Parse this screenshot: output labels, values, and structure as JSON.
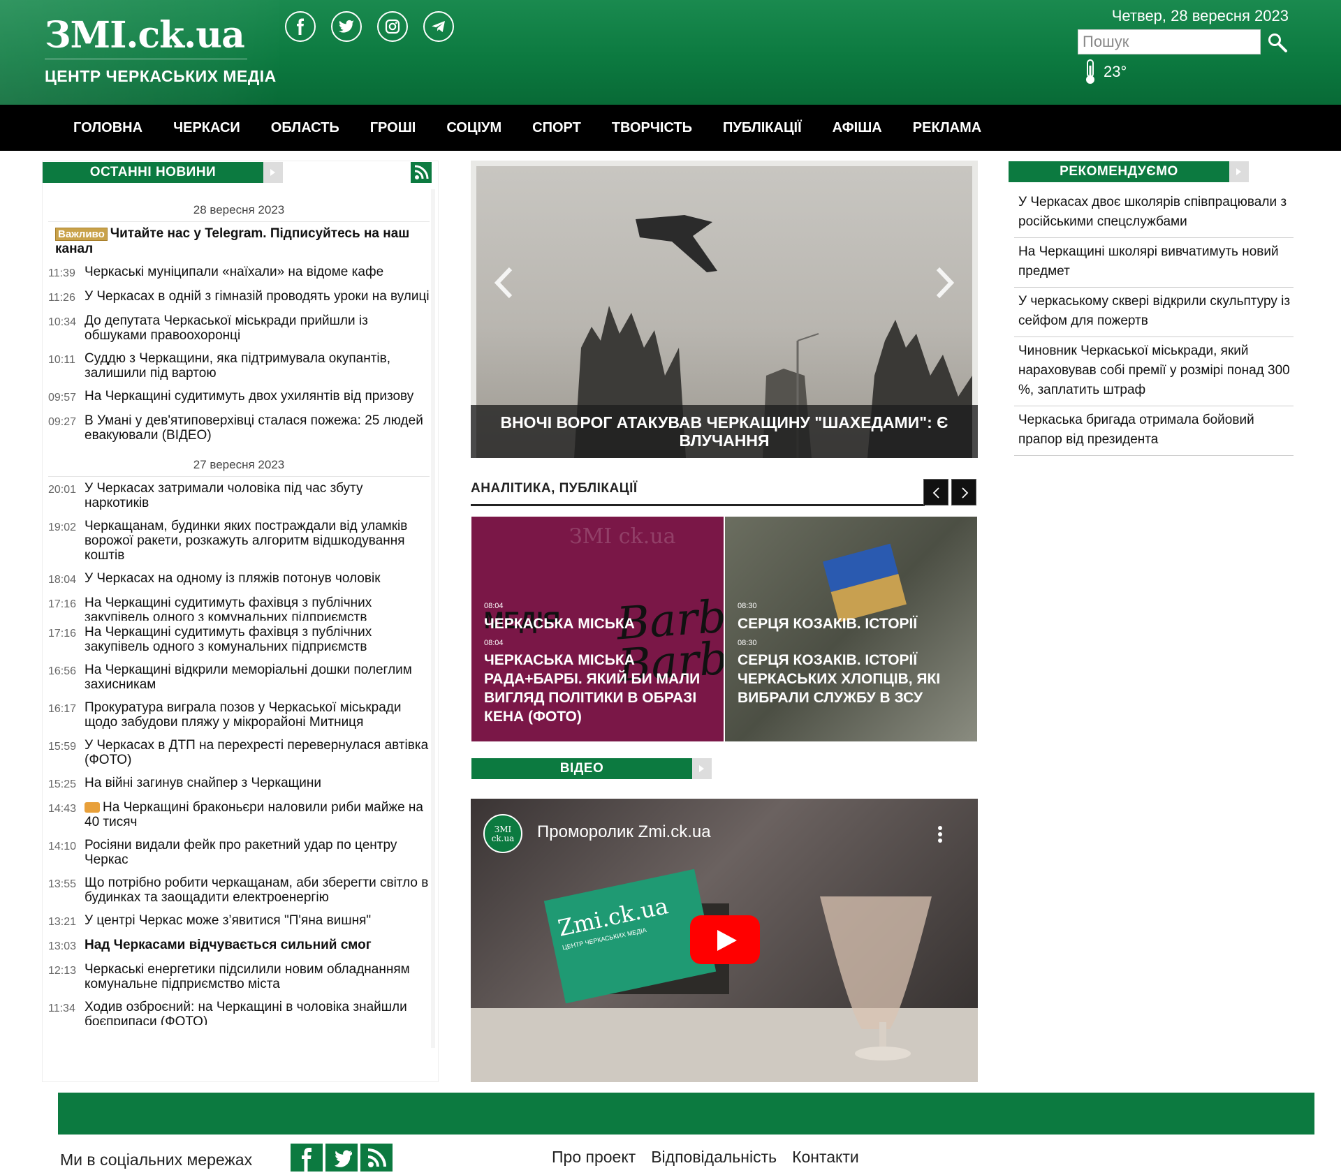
{
  "header": {
    "logo": "ЗМІ.ck.ua",
    "logo_sub": "ЦЕНТР ЧЕРКАСЬКИХ МЕДІА",
    "date": "Четвер, 28 вересня 2023",
    "search_placeholder": "Пошук",
    "temperature": "23°",
    "socials": [
      "facebook-icon",
      "twitter-icon",
      "instagram-icon",
      "telegram-icon"
    ],
    "color_primary": "#0c7a40"
  },
  "nav": [
    "ГОЛОВНА",
    "ЧЕРКАСИ",
    "ОБЛАСТЬ",
    "ГРОШІ",
    "СОЦІУМ",
    "СПОРТ",
    "ТВОРЧІСТЬ",
    "ПУБЛІКАЦІЇ",
    "АФІША",
    "РЕКЛАМА"
  ],
  "latest": {
    "title": "ОСТАННІ НОВИНИ",
    "groups": [
      {
        "date": "28 вересня 2023",
        "items": [
          {
            "time": "",
            "badge": "Важливо",
            "text": "Читайте нас у Telegram. Підписуйтесь на наш канал",
            "bold": true
          },
          {
            "time": "11:39",
            "text": "Черкаські муніципали «наїхали» на відоме кафе"
          },
          {
            "time": "11:26",
            "text": "У Черкасах в одній з гімназій проводять уроки на вулиці"
          },
          {
            "time": "10:34",
            "text": "До депутата Черкаської міськради прийшли із обшуками правоохоронці"
          },
          {
            "time": "10:11",
            "text": "Суддю з Черкащини, яка підтримувала окупантів, залишили під вартою"
          },
          {
            "time": "09:57",
            "text": "На Черкащині судитимуть двох ухилянтів від призову"
          },
          {
            "time": "09:27",
            "text": "В Умані у дев'ятиповерхівці сталася пожежа: 25 людей евакуювали (ВІДЕО)"
          }
        ]
      },
      {
        "date": "27 вересня 2023",
        "items": [
          {
            "time": "20:01",
            "text": "У Черкасах затримали чоловіка під час збуту наркотиків"
          },
          {
            "time": "19:02",
            "text": "Черкащанам, будинки яких постраждали від уламків ворожої ракети, розкажуть алгоритм відшкодування коштів"
          },
          {
            "time": "18:04",
            "text": "У Черкасах на одному із пляжів потонув чоловік"
          },
          {
            "time": "17:16",
            "text": "На Черкащині судитимуть фахівця з публічних закупівель одного з комунальних підприємств",
            "clip": true
          },
          {
            "time": "17:16",
            "text": "На Черкащині судитимуть фахівця з публічних закупівель  одного з комунальних підприємств"
          },
          {
            "time": "16:56",
            "text": "На Черкащині відкрили меморіальні дошки полеглим захисникам"
          },
          {
            "time": "16:17",
            "text": "Прокуратура виграла позов у Черкаської міськради щодо забудови пляжу у мікрорайоні Митниця"
          },
          {
            "time": "15:59",
            "text": "У Черкасах в ДТП на перехресті перевернулася автівка (ФОТО)"
          },
          {
            "time": "15:25",
            "text": "На війні загинув снайпер з Черкащини"
          },
          {
            "time": "14:43",
            "text": "На Черкащині браконьєри наловили риби майже на 40 тисяч",
            "photo": true
          },
          {
            "time": "14:10",
            "text": "Росіяни видали фейк про ракетний удар по центру Черкас"
          },
          {
            "time": "13:55",
            "text": "Що потрібно робити черкащанам, аби зберегти світло в будинках та заощадити електроенергію"
          },
          {
            "time": "13:21",
            "text": "У центрі Черкас може з’явитися \"П'яна вишня\""
          },
          {
            "time": "13:03",
            "text": "Над Черкасами відчувається сильний смог",
            "bold": true
          },
          {
            "time": "12:13",
            "text": "Черкаські енергетики підсилили новим обладнанням комунальне підприємство міста"
          },
          {
            "time": "11:34",
            "text": "Ходив озброєний: на Черкащині в чоловіка знайшли боєприпаси (ФОТО)",
            "clip": true
          }
        ]
      }
    ]
  },
  "slider": {
    "caption": "ВНОЧІ ВОРОГ АТАКУВАВ ЧЕРКАЩИНУ \"ШАХЕДАМИ\": Є ВЛУЧАННЯ"
  },
  "analytics": {
    "title": "АНАЛІТИКА, ПУБЛІКАЦІЇ",
    "cards": [
      {
        "time": "08:04",
        "title": "ЧЕРКАСЬКА МІСЬКА РАДА+БАРБІ. ЯКИЙ БИ МАЛИ ВИГЛЯД ПОЛІТИКИ В ОБРАЗІ КЕНА (ФОТО)",
        "ghost": "ЧЕРКАСЬКА МІСЬКА",
        "bg": "#7a1747"
      },
      {
        "time": "08:30",
        "title": "СЕРЦЯ КОЗАКІВ. ІСТОРІЇ ЧЕРКАСЬКИХ ХЛОПЦІВ, ЯКІ ВИБРАЛИ СЛУЖБУ В ЗСУ",
        "ghost": "СЕРЦЯ КОЗАКІВ. ІСТОРІЇ",
        "bg": "#5b5e52"
      }
    ],
    "watermark": "ЗМІ ck.ua",
    "barbie_text": "Barbie",
    "media_text": "МЕДІЯ"
  },
  "video": {
    "section_title": "ВІДЕО",
    "title": "Проморолик Zmi.ck.ua",
    "channel": "ЗМІ ck.ua",
    "card_text": "Zmi.ck.ua",
    "card_sub": "ЦЕНТР ЧЕРКАСЬКИХ МЕДІА"
  },
  "recommend": {
    "title": "РЕКОМЕНДУЄМО",
    "items": [
      " У Черкасах двоє школярів співпрацювали з російськими спецслужбами",
      "На Черкащині школярі вивчатимуть новий предмет",
      "У черкаському сквері відкрили скульптуру із сейфом для пожертв",
      "Чиновник Черкаської міськради, який нараховував собі премії у розмірі понад 300 %, заплатить штраф",
      "Черкаська бригада отримала бойовий прапор від президента"
    ]
  },
  "footer": {
    "social_label": "Ми в соціальних мережах",
    "links": [
      "Про проект",
      "Відповідальність",
      "Контакти"
    ]
  }
}
